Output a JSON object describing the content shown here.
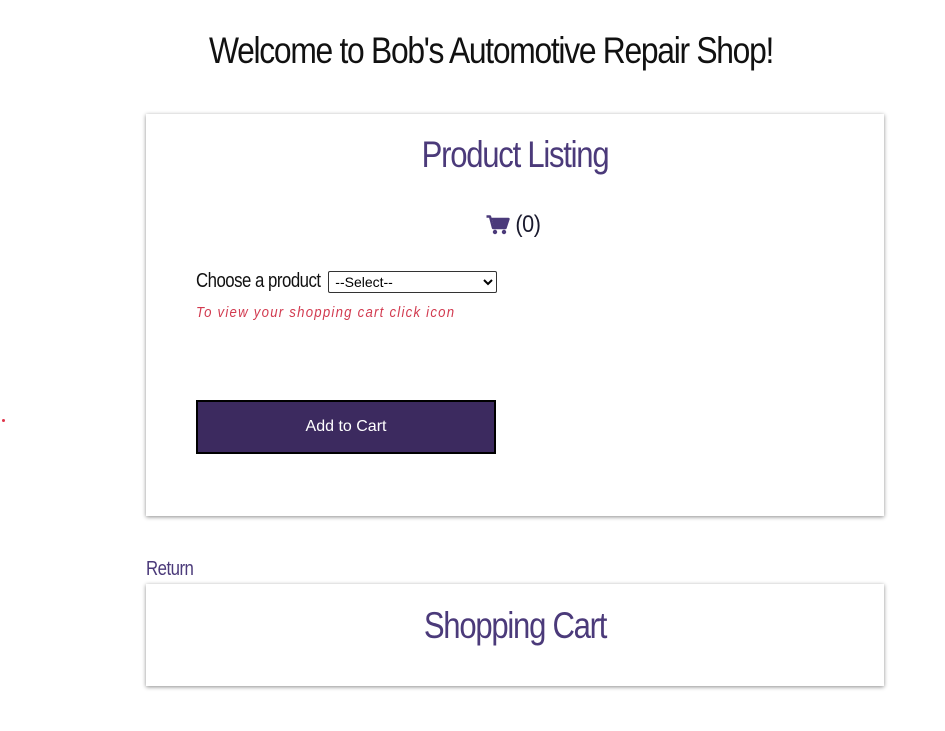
{
  "header": {
    "title": "Welcome to Bob's Automotive Repair Shop!"
  },
  "listing": {
    "title": "Product Listing",
    "cart_icon": "shopping-cart-icon",
    "cart_count": "(0)",
    "choose_label": "Choose a product",
    "select": {
      "selected": "--Select--",
      "options": [
        "--Select--"
      ]
    },
    "hint": "To view your shopping cart click icon",
    "add_button": "Add to Cart"
  },
  "return_link": "Return",
  "cart": {
    "title": "Shopping Cart"
  },
  "colors": {
    "accent": "#4b3a7a",
    "button_bg": "#3c2a5f",
    "hint": "#d23b50"
  }
}
